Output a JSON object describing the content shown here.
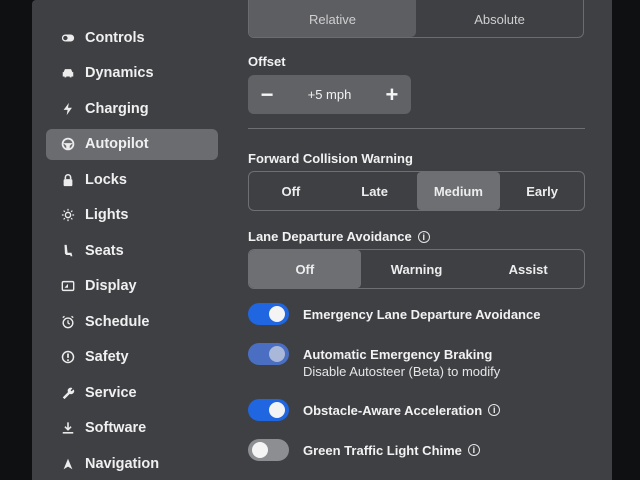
{
  "sidebar": {
    "items": [
      {
        "label": "Controls",
        "icon": "toggle-icon"
      },
      {
        "label": "Dynamics",
        "icon": "car-icon"
      },
      {
        "label": "Charging",
        "icon": "lightning-icon"
      },
      {
        "label": "Autopilot",
        "icon": "steering-wheel-icon",
        "active": true
      },
      {
        "label": "Locks",
        "icon": "lock-icon"
      },
      {
        "label": "Lights",
        "icon": "sun-icon"
      },
      {
        "label": "Seats",
        "icon": "seat-icon"
      },
      {
        "label": "Display",
        "icon": "display-icon"
      },
      {
        "label": "Schedule",
        "icon": "alarm-clock-icon"
      },
      {
        "label": "Safety",
        "icon": "alert-icon"
      },
      {
        "label": "Service",
        "icon": "wrench-icon"
      },
      {
        "label": "Software",
        "icon": "download-icon"
      },
      {
        "label": "Navigation",
        "icon": "navigation-arrow-icon"
      }
    ]
  },
  "speed_mode": {
    "options": [
      "Relative",
      "Absolute"
    ],
    "selected": "Relative"
  },
  "offset": {
    "label": "Offset",
    "minus": "−",
    "plus": "+",
    "value": "+5 mph"
  },
  "fcw": {
    "label": "Forward Collision Warning",
    "options": [
      "Off",
      "Late",
      "Medium",
      "Early"
    ],
    "selected": "Medium"
  },
  "lda": {
    "label": "Lane Departure Avoidance",
    "info": "i",
    "options": [
      "Off",
      "Warning",
      "Assist"
    ],
    "selected": "Off"
  },
  "toggles": [
    {
      "title": "Emergency Lane Departure Avoidance",
      "state": "on",
      "subtitle": "",
      "info": ""
    },
    {
      "title": "Automatic Emergency Braking",
      "state": "dim",
      "subtitle": "Disable Autosteer (Beta) to modify",
      "info": ""
    },
    {
      "title": "Obstacle-Aware Acceleration",
      "state": "on",
      "subtitle": "",
      "info": "i"
    },
    {
      "title": "Green Traffic Light Chime",
      "state": "off",
      "subtitle": "",
      "info": "i"
    }
  ],
  "colors": {
    "toggle_on": "#1f66e0",
    "panel_bg": "#3e4044",
    "active_nav": "#6a6c70"
  }
}
